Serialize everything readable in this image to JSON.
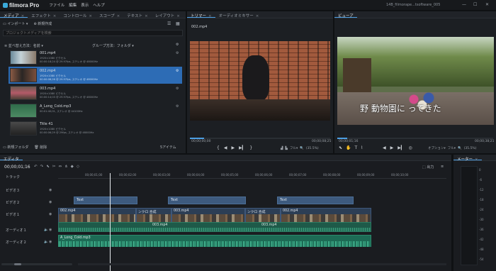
{
  "app": {
    "name": "filmora Pro",
    "window_title": "14B_filmorape...tsoftware_005",
    "menu": [
      "ファイル",
      "編集",
      "表示",
      "ヘルプ"
    ]
  },
  "media_panel": {
    "tabs": [
      "メディア",
      "エフェクト",
      "コントロール",
      "スコープ",
      "テキスト",
      "レイアウト"
    ],
    "import_label": "インポート",
    "new_comp_label": "新規作成",
    "search_placeholder": "プロジェクトメディアを検索",
    "sort_label": "並べ替え方法：名前",
    "group_label": "グループ方法：フォルダ",
    "items": [
      {
        "name": "001.mp4",
        "line1": "1920×1080 ピクセル",
        "line2": "00:00:18;24 @ 29.97fps, ステレオ @ 48000Hz",
        "selected": false
      },
      {
        "name": "002.mp4",
        "line1": "1920×1080 ピクセル",
        "line2": "00:00:08;26 @ 29.97fps, ステレオ @ 48000Hz",
        "selected": true
      },
      {
        "name": "003.mp4",
        "line1": "1920×1080 ピクセル",
        "line2": "00:00:14;03 @ 29.97fps, ステレオ @ 48000Hz",
        "selected": false
      },
      {
        "name": "A_Long_Cold.mp3",
        "line1": "",
        "line2": "00:01:40;01, ステレオ @ 44100Hz",
        "selected": false
      },
      {
        "name": "Title 41",
        "line1": "1920×1080 ピクセル",
        "line2": "00:00:06;29 @ 29fps, ステレオ @ 48000Hz",
        "selected": false
      }
    ],
    "new_folder_label": "新規フォルダ",
    "delete_label": "削除",
    "item_count": "5アイテム"
  },
  "trimmer": {
    "tabs": [
      "トリマー",
      "オーディオミキサー"
    ],
    "clip_name": "002.mp4",
    "time_start": "00;00;00;00",
    "time_end": "00;00;08;25",
    "full_label": "フル",
    "zoom": "(35.5%)"
  },
  "viewer": {
    "tab": "ビューア",
    "subtitle": "野 動物園に  ってきた",
    "time_start": "00;00;01;16",
    "time_end": "00;00;38;21",
    "options_label": "オプション",
    "full_label": "フル",
    "zoom": "(35.5%)"
  },
  "editor": {
    "tab": "エディタ",
    "timecode": "00;00;01;16",
    "output_label": "出力",
    "ruler": [
      "00;00;01;00",
      "00;00;02;00",
      "00;00;03;00",
      "00;00;04;00",
      "00;00;05;00",
      "00;00;06;00",
      "00;00;07;00",
      "00;00;08;00",
      "00;00;09;00",
      "00;00;10;00"
    ],
    "tracks": [
      "トラック",
      "ビデオ３",
      "ビデオ２",
      "ビデオ１",
      "オーディオ１",
      "オーディオ２"
    ],
    "text_clips": [
      "Text",
      "Text",
      "Text"
    ],
    "video_clips": [
      "002.mp4",
      "ンクロ 合成",
      "003.mp4",
      "ンクロ 合成",
      "002.mp4"
    ],
    "mid_clips": [
      "003.mp4",
      "003.mp4"
    ],
    "audio_clip": "A_Long_Cold.mp3"
  },
  "meter": {
    "tab": "メーター",
    "labels": [
      "0",
      "-6",
      "-12",
      "-18",
      "-24",
      "-30",
      "-36",
      "-42",
      "-48",
      "-54"
    ]
  },
  "colors": {
    "accent": "#4d9fe3",
    "selected_row": "#2d6cb5",
    "text_clip": "#3d5a7e",
    "audio_clip": "#1d6b55"
  }
}
